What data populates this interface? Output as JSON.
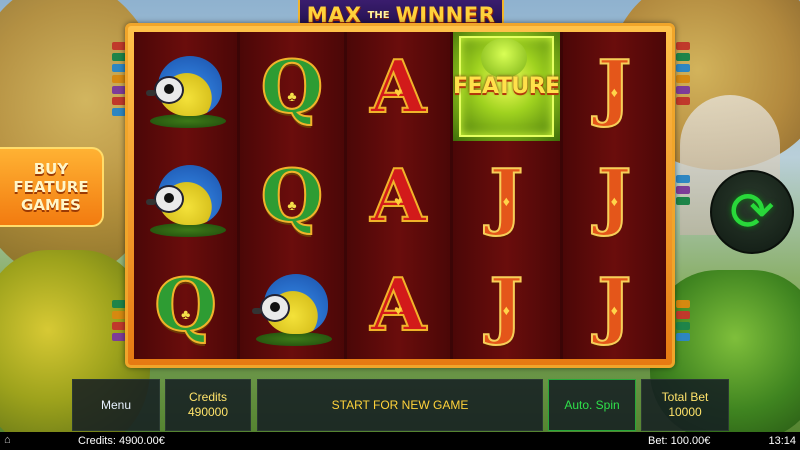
{
  "game": {
    "title_word1": "MAX",
    "title_word_the": "THE",
    "title_word2": "WINNER"
  },
  "reels": [
    {
      "symbols": [
        "bird",
        "bird",
        "Q"
      ]
    },
    {
      "symbols": [
        "Q",
        "Q",
        "bird"
      ]
    },
    {
      "symbols": [
        "A",
        "A",
        "A"
      ]
    },
    {
      "symbols": [
        "FEATURE",
        "J",
        "J"
      ]
    },
    {
      "symbols": [
        "J",
        "J",
        "J"
      ]
    }
  ],
  "feature_label": "FEATURE",
  "buy_feature": {
    "label": "BUY\nFEATURE\nGAMES"
  },
  "controls": {
    "menu_label": "Menu",
    "credits_label": "Credits",
    "credits_value": "490000",
    "message": "START FOR NEW GAME",
    "auto_spin_label": "Auto. Spin",
    "total_bet_label": "Total Bet",
    "total_bet_value": "10000",
    "spin_icon": "refresh-arrows-icon"
  },
  "status_bar": {
    "credits": "Credits: 4900.00€",
    "bet": "Bet: 100.00€",
    "time": "13:14",
    "home_icon": "home-icon"
  },
  "colors": {
    "frame": "#f0a52a",
    "reel_bg": "#5a0a0a",
    "spin_green": "#29d83a",
    "panel_text": "#ffe36a",
    "auto_spin_text": "#2ee04a"
  }
}
